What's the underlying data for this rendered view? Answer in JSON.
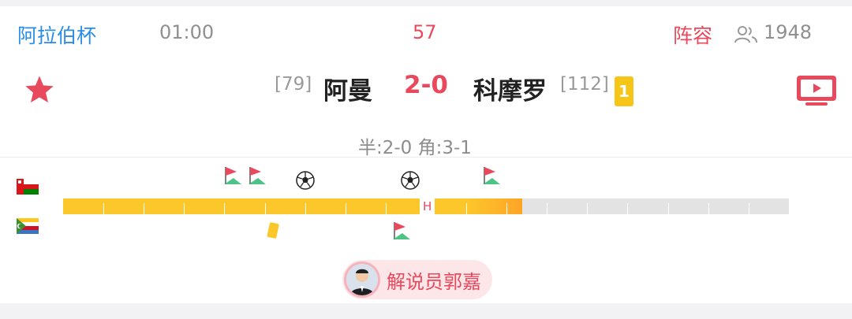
{
  "header": {
    "league": "阿拉伯杯",
    "kickoff_time": "01:00",
    "match_minute": "57",
    "lineup_label": "阵容",
    "viewer_count": "1948",
    "people_icon": "people-icon"
  },
  "match": {
    "home_rank": "[79]",
    "home_team": "阿曼",
    "score": "2-0",
    "away_team": "科摩罗",
    "away_rank": "[112]",
    "away_yellow_cards": "1",
    "summary": "半:2-0 角:3-1",
    "favorite_icon": "star-icon",
    "video_icon": "tv-play-icon"
  },
  "timeline": {
    "half_marker": "H",
    "home_flag": "oman-flag",
    "away_flag": "comoros-flag",
    "progress_fraction": 0.633,
    "colors": {
      "fill": "#fcc72a",
      "track": "#e3e3e3",
      "accent": "#e8495d"
    },
    "events": [
      {
        "team": "home",
        "type": "corner"
      },
      {
        "team": "home",
        "type": "corner"
      },
      {
        "team": "home",
        "type": "goal"
      },
      {
        "team": "home",
        "type": "goal"
      },
      {
        "team": "home",
        "type": "corner"
      },
      {
        "team": "away",
        "type": "yellow-card"
      },
      {
        "team": "away",
        "type": "corner"
      }
    ]
  },
  "commentator": {
    "label": "解说员郭嘉"
  }
}
